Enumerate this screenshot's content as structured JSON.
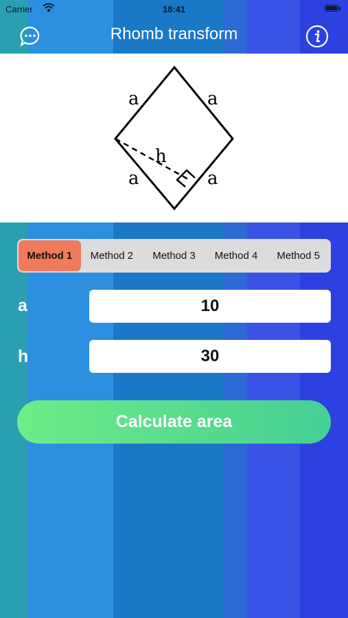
{
  "status_bar": {
    "carrier": "Carrier",
    "time": "18:41"
  },
  "header": {
    "title": "Rhomb transform",
    "left_icon": "chat-bubble-icon",
    "right_icon": "info-icon"
  },
  "figure": {
    "side_label": "a",
    "height_label": "h"
  },
  "methods": {
    "tabs": [
      {
        "label": "Method 1"
      },
      {
        "label": "Method 2"
      },
      {
        "label": "Method 3"
      },
      {
        "label": "Method 4"
      },
      {
        "label": "Method 5"
      }
    ],
    "active_index": 0
  },
  "fields": {
    "a": {
      "label": "a",
      "value": "10"
    },
    "h": {
      "label": "h",
      "value": "30"
    }
  },
  "action": {
    "label": "Calculate area"
  },
  "colors": {
    "active_tab": "#f07a5c",
    "button_start": "#6fed8a",
    "button_end": "#46cf97",
    "header_text": "#ffffff"
  }
}
